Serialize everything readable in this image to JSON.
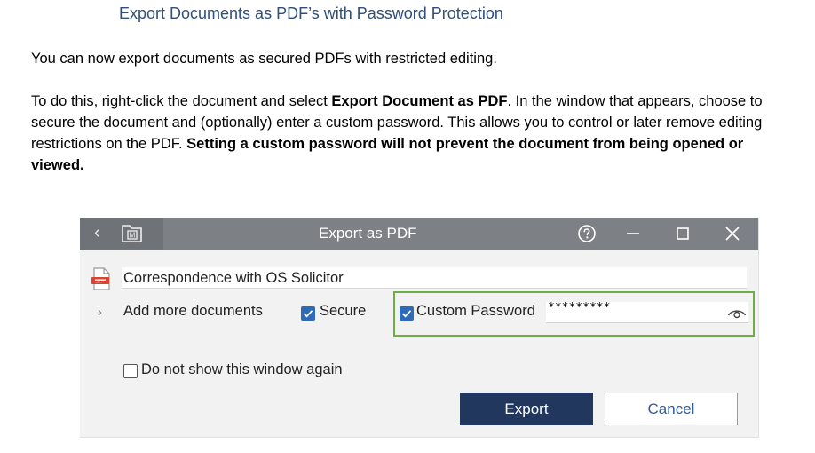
{
  "document": {
    "heading": "Export Documents as PDF’s with Password Protection",
    "paragraph1": "You can now export documents as secured PDFs with restricted editing.",
    "paragraph2": {
      "part1": "To do this, right-click the document and select ",
      "bold1": "Export Document as PDF",
      "part2": ". In the window that appears, choose to secure the document and (optionally) enter a custom password. This allows you to control or later remove editing restrictions on the PDF. ",
      "bold2": "Setting a custom password will not prevent the document from being opened or viewed."
    }
  },
  "dialog": {
    "title": "Export as PDF",
    "logo_letter": "M",
    "document_name": "Correspondence with OS Solicitor",
    "add_more_label": "Add more documents",
    "secure_label": "Secure",
    "secure_checked": true,
    "custom_password_label": "Custom Password",
    "custom_password_checked": true,
    "password_value": "*********",
    "do_not_show_label": "Do not show this window again",
    "do_not_show_checked": false,
    "export_button": "Export",
    "cancel_button": "Cancel"
  },
  "colors": {
    "heading": "#2f4e79",
    "titlebar": "#7d8186",
    "export_button_bg": "#22375d",
    "checkbox_checked": "#2d6bb8",
    "highlight_border": "#70ad47",
    "cancel_text": "#2f5e9e"
  },
  "icons": {
    "back": "chevron-left-icon",
    "logo": "folder-m-logo-icon",
    "help": "help-circle-icon",
    "minimize": "minimize-icon",
    "maximize": "maximize-icon",
    "close": "close-icon",
    "file": "pdf-file-icon",
    "expand": "chevron-right-icon",
    "reveal": "eye-icon"
  }
}
